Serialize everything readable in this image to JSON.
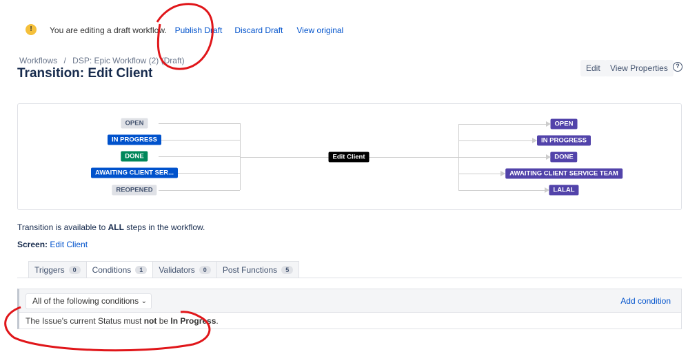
{
  "banner": {
    "icon": "warning-icon",
    "message": "You are editing a draft workflow.",
    "publish": "Publish Draft",
    "discard": "Discard Draft",
    "view_original": "View original"
  },
  "breadcrumb": {
    "workflows": "Workflows",
    "separator": "/",
    "workflow": "DSP: Epic Workflow (2) (Draft)"
  },
  "title": "Transition: Edit Client",
  "actions": {
    "edit": "Edit",
    "view_properties": "View Properties",
    "help": "?"
  },
  "diagram": {
    "from": [
      {
        "label": "OPEN",
        "color": "grey"
      },
      {
        "label": "IN PROGRESS",
        "color": "blue"
      },
      {
        "label": "DONE",
        "color": "green"
      },
      {
        "label": "AWAITING CLIENT SER...",
        "color": "blue"
      },
      {
        "label": "REOPENED",
        "color": "grey"
      }
    ],
    "transition": "Edit Client",
    "to": [
      {
        "label": "OPEN"
      },
      {
        "label": "IN PROGRESS"
      },
      {
        "label": "DONE"
      },
      {
        "label": "AWAITING CLIENT SERVICE TEAM"
      },
      {
        "label": "LALAL"
      }
    ]
  },
  "availability": {
    "prefix": "Transition is available to ",
    "emph": "ALL",
    "suffix": " steps in the workflow."
  },
  "screen": {
    "label": "Screen:",
    "value": "Edit Client"
  },
  "tabs": [
    {
      "label": "Triggers",
      "count": "0"
    },
    {
      "label": "Conditions",
      "count": "1",
      "active": true
    },
    {
      "label": "Validators",
      "count": "0"
    },
    {
      "label": "Post Functions",
      "count": "5"
    }
  ],
  "conditions": {
    "select": "All of the following conditions",
    "add": "Add condition",
    "row": {
      "p1": "The Issue's current Status must ",
      "b1": "not",
      "p2": " be ",
      "b2": "In Progress",
      "p3": "."
    }
  }
}
